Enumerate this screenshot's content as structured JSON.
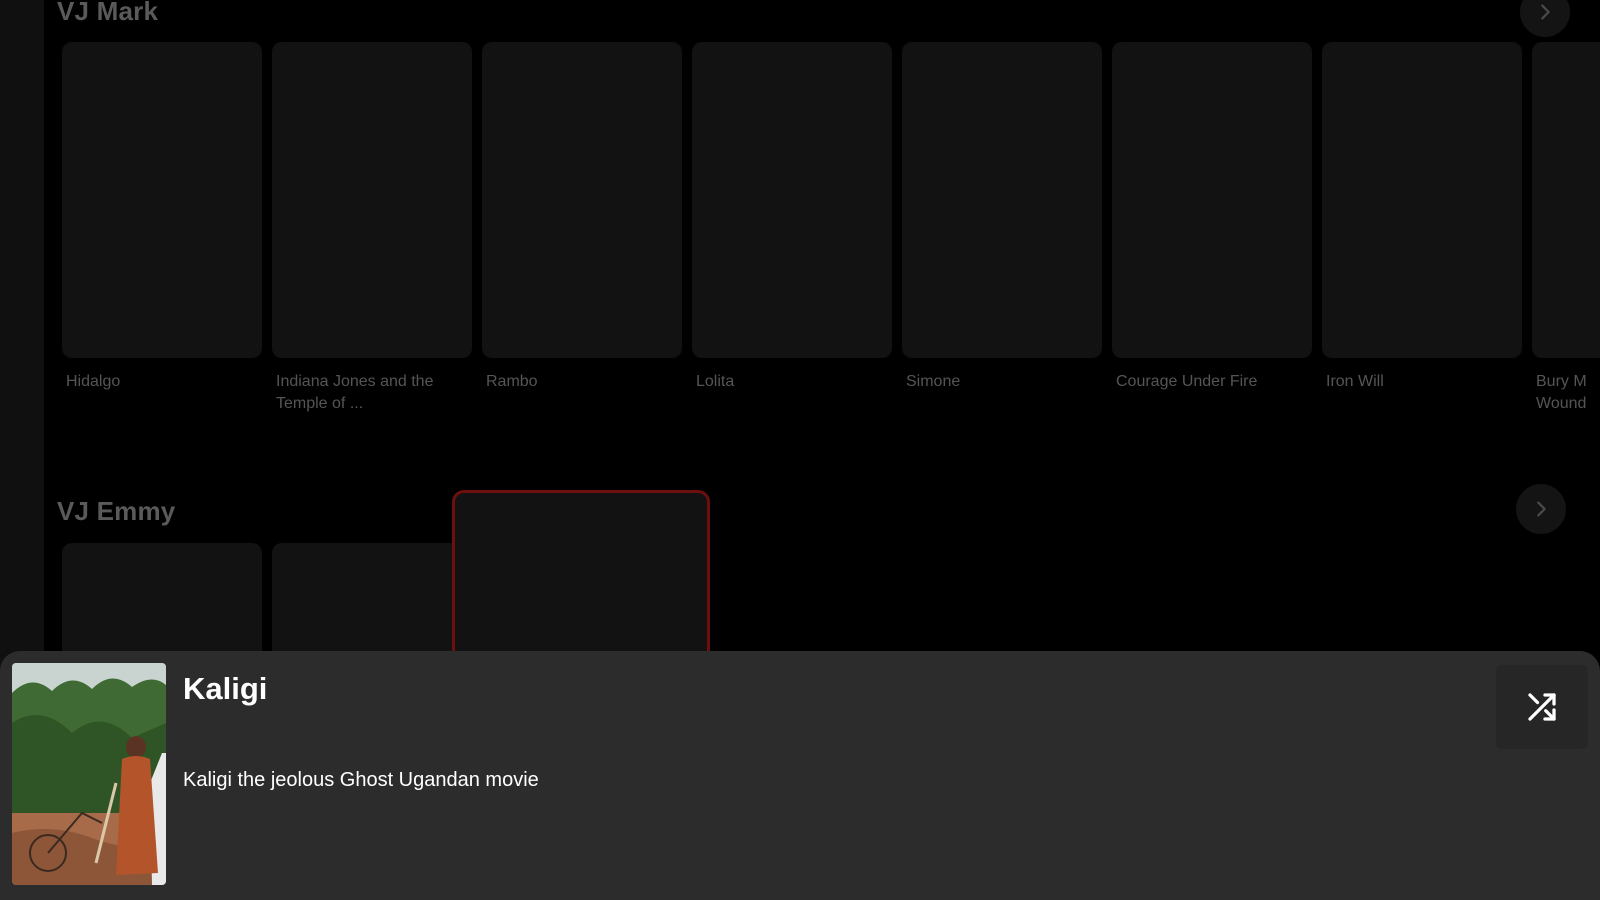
{
  "sections": [
    {
      "title": "VJ Mark",
      "items": [
        {
          "label": "Hidalgo"
        },
        {
          "label": "Indiana Jones and the Temple of ..."
        },
        {
          "label": "Rambo"
        },
        {
          "label": "Lolita"
        },
        {
          "label": "Simone"
        },
        {
          "label": "Courage Under Fire"
        },
        {
          "label": "Iron Will"
        }
      ],
      "partial_item": {
        "label_line1": "Bury M",
        "label_line2": "Wound"
      }
    },
    {
      "title": "VJ Emmy"
    }
  ],
  "player": {
    "title": "Kaligi",
    "description": "Kaligi the jeolous Ghost  Ugandan movie"
  },
  "icons": {
    "next": "chevron-right-icon",
    "shuffle": "shuffle-icon"
  },
  "colors": {
    "focus_border": "#6e0f0f",
    "player_bg": "#2c2c2c",
    "background": "#000000"
  }
}
